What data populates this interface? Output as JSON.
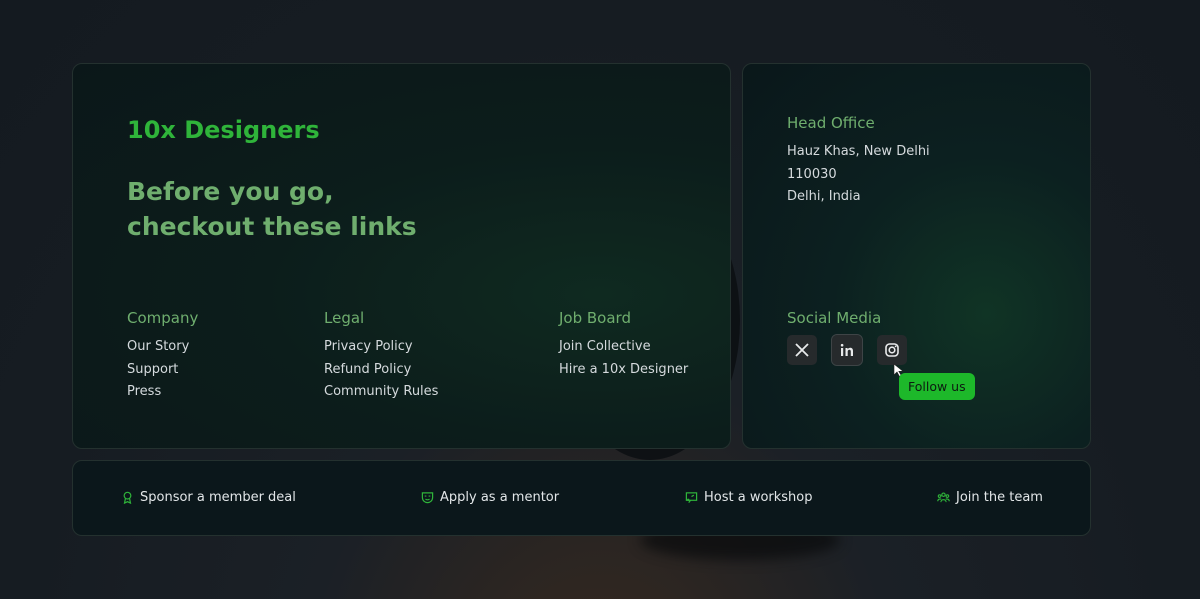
{
  "brand": "10x Designers",
  "headline": [
    "Before you go,",
    "checkout these links"
  ],
  "columns": {
    "company": {
      "title": "Company",
      "links": [
        "Our Story",
        "Support",
        "Press"
      ]
    },
    "legal": {
      "title": "Legal",
      "links": [
        "Privacy Policy",
        "Refund Policy",
        "Community Rules"
      ]
    },
    "job_board": {
      "title": "Job Board",
      "links": [
        "Join Collective",
        "Hire a 10x Designer"
      ]
    }
  },
  "office": {
    "title": "Head Office",
    "lines": [
      "Hauz Khas, New Delhi",
      "110030",
      "Delhi, India"
    ]
  },
  "social": {
    "title": "Social Media",
    "icons": [
      "x-icon",
      "linkedin-icon",
      "instagram-icon"
    ],
    "tooltip": "Follow us"
  },
  "actions": [
    {
      "label": "Sponsor a member deal",
      "icon": "award-icon"
    },
    {
      "label": "Apply as a mentor",
      "icon": "mask-icon"
    },
    {
      "label": "Host a workshop",
      "icon": "presentation-icon"
    },
    {
      "label": "Join the team",
      "icon": "team-icon"
    }
  ],
  "colors": {
    "brand_green": "#2fb43a",
    "muted_green": "#6fae6e",
    "tooltip_green": "#1db82a"
  }
}
